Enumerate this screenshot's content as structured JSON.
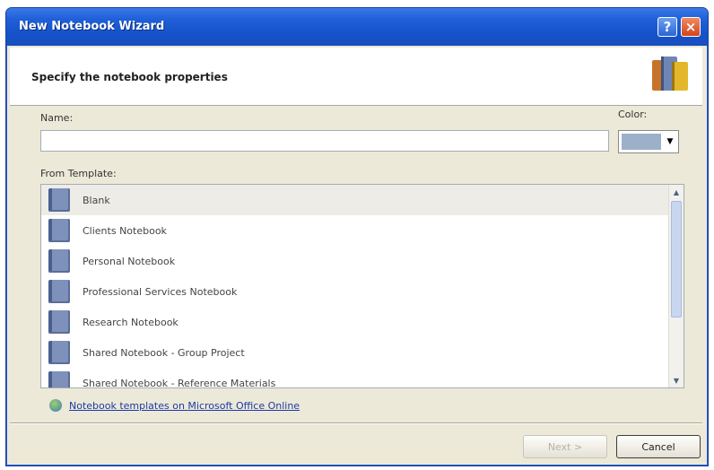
{
  "window": {
    "title": "New Notebook Wizard",
    "help_label": "?",
    "close_label": "×"
  },
  "header": {
    "title": "Specify the notebook properties"
  },
  "form": {
    "name_label": "Name:",
    "name_value": "",
    "color_label": "Color:",
    "color_value": "#9cb0c9",
    "template_label": "From Template:"
  },
  "templates": [
    {
      "label": "Blank",
      "selected": true
    },
    {
      "label": "Clients Notebook",
      "selected": false
    },
    {
      "label": "Personal Notebook",
      "selected": false
    },
    {
      "label": "Professional Services Notebook",
      "selected": false
    },
    {
      "label": "Research Notebook",
      "selected": false
    },
    {
      "label": "Shared Notebook - Group Project",
      "selected": false
    },
    {
      "label": "Shared Notebook - Reference Materials",
      "selected": false
    }
  ],
  "online_link": "Notebook templates on Microsoft Office Online",
  "buttons": {
    "next": "Next >",
    "cancel": "Cancel"
  }
}
